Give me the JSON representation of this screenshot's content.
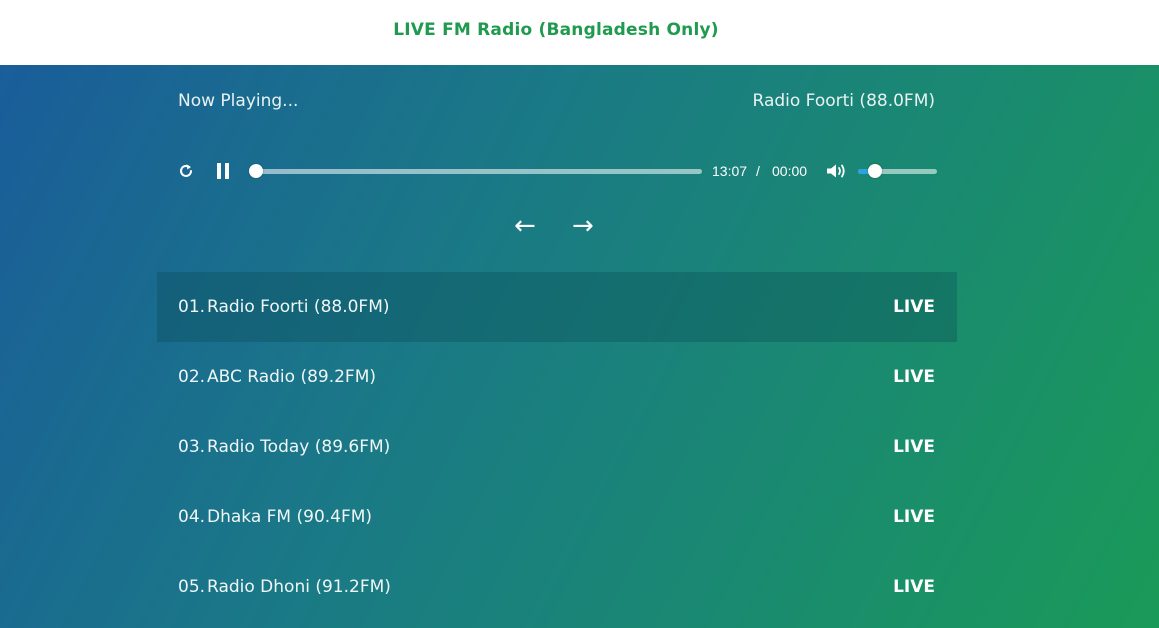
{
  "header": {
    "title": "LIVE FM Radio (Bangladesh Only)",
    "title_color": "#1f9a4f"
  },
  "now_playing": {
    "label": "Now Playing...",
    "station": "Radio Foorti (88.0FM)"
  },
  "player": {
    "reload_icon": "reload-icon",
    "pause_icon": "pause-icon",
    "current_time": "13:07",
    "separator": "/",
    "duration": "00:00",
    "progress": 0,
    "volume_icon": "volume-icon",
    "volume_level": 0.16,
    "volume_color": "#2aa3e0"
  },
  "navigation": {
    "prev_symbol": "←",
    "next_symbol": "→"
  },
  "playlist": [
    {
      "num": "01.",
      "name": "Radio Foorti (88.0FM)",
      "badge": "LIVE",
      "active": true
    },
    {
      "num": "02.",
      "name": "ABC Radio (89.2FM)",
      "badge": "LIVE",
      "active": false
    },
    {
      "num": "03.",
      "name": "Radio Today (89.6FM)",
      "badge": "LIVE",
      "active": false
    },
    {
      "num": "04.",
      "name": "Dhaka FM (90.4FM)",
      "badge": "LIVE",
      "active": false
    },
    {
      "num": "05.",
      "name": "Radio Dhoni (91.2FM)",
      "badge": "LIVE",
      "active": false
    }
  ]
}
